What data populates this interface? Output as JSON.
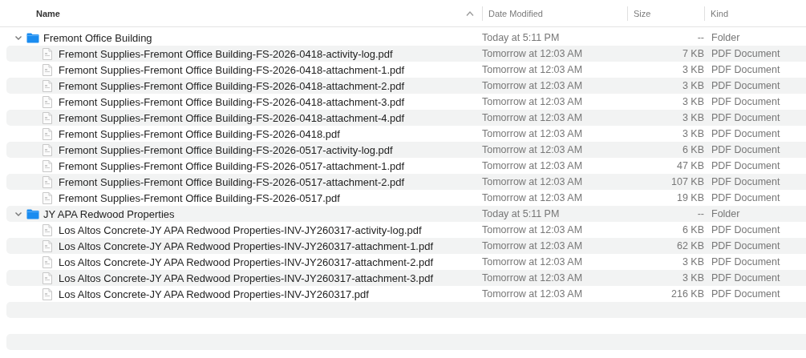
{
  "columns": [
    {
      "label": "Name",
      "sorted": true
    },
    {
      "label": "Date Modified",
      "sorted": false
    },
    {
      "label": "Size",
      "sorted": false
    },
    {
      "label": "Kind",
      "sorted": false
    }
  ],
  "items": [
    {
      "kind": "folder",
      "name": "Fremont Office Building",
      "date": "Today at 5:11 PM",
      "size": "--",
      "type": "Folder",
      "expanded": true,
      "children": [
        {
          "kind": "file",
          "name": "Fremont Supplies-Fremont Office Building-FS-2026-0418-activity-log.pdf",
          "date": "Tomorrow at 12:03 AM",
          "size": "7 KB",
          "type": "PDF Document"
        },
        {
          "kind": "file",
          "name": "Fremont Supplies-Fremont Office Building-FS-2026-0418-attachment-1.pdf",
          "date": "Tomorrow at 12:03 AM",
          "size": "3 KB",
          "type": "PDF Document"
        },
        {
          "kind": "file",
          "name": "Fremont Supplies-Fremont Office Building-FS-2026-0418-attachment-2.pdf",
          "date": "Tomorrow at 12:03 AM",
          "size": "3 KB",
          "type": "PDF Document"
        },
        {
          "kind": "file",
          "name": "Fremont Supplies-Fremont Office Building-FS-2026-0418-attachment-3.pdf",
          "date": "Tomorrow at 12:03 AM",
          "size": "3 KB",
          "type": "PDF Document"
        },
        {
          "kind": "file",
          "name": "Fremont Supplies-Fremont Office Building-FS-2026-0418-attachment-4.pdf",
          "date": "Tomorrow at 12:03 AM",
          "size": "3 KB",
          "type": "PDF Document"
        },
        {
          "kind": "file",
          "name": "Fremont Supplies-Fremont Office Building-FS-2026-0418.pdf",
          "date": "Tomorrow at 12:03 AM",
          "size": "3 KB",
          "type": "PDF Document"
        },
        {
          "kind": "file",
          "name": "Fremont Supplies-Fremont Office Building-FS-2026-0517-activity-log.pdf",
          "date": "Tomorrow at 12:03 AM",
          "size": "6 KB",
          "type": "PDF Document"
        },
        {
          "kind": "file",
          "name": "Fremont Supplies-Fremont Office Building-FS-2026-0517-attachment-1.pdf",
          "date": "Tomorrow at 12:03 AM",
          "size": "47 KB",
          "type": "PDF Document"
        },
        {
          "kind": "file",
          "name": "Fremont Supplies-Fremont Office Building-FS-2026-0517-attachment-2.pdf",
          "date": "Tomorrow at 12:03 AM",
          "size": "107 KB",
          "type": "PDF Document"
        },
        {
          "kind": "file",
          "name": "Fremont Supplies-Fremont Office Building-FS-2026-0517.pdf",
          "date": "Tomorrow at 12:03 AM",
          "size": "19 KB",
          "type": "PDF Document"
        }
      ]
    },
    {
      "kind": "folder",
      "name": "JY APA Redwood Properties",
      "date": "Today at 5:11 PM",
      "size": "--",
      "type": "Folder",
      "expanded": true,
      "children": [
        {
          "kind": "file",
          "name": "Los Altos Concrete-JY APA Redwood Properties-INV-JY260317-activity-log.pdf",
          "date": "Tomorrow at 12:03 AM",
          "size": "6 KB",
          "type": "PDF Document"
        },
        {
          "kind": "file",
          "name": "Los Altos Concrete-JY APA Redwood Properties-INV-JY260317-attachment-1.pdf",
          "date": "Tomorrow at 12:03 AM",
          "size": "62 KB",
          "type": "PDF Document"
        },
        {
          "kind": "file",
          "name": "Los Altos Concrete-JY APA Redwood Properties-INV-JY260317-attachment-2.pdf",
          "date": "Tomorrow at 12:03 AM",
          "size": "3 KB",
          "type": "PDF Document"
        },
        {
          "kind": "file",
          "name": "Los Altos Concrete-JY APA Redwood Properties-INV-JY260317-attachment-3.pdf",
          "date": "Tomorrow at 12:03 AM",
          "size": "3 KB",
          "type": "PDF Document"
        },
        {
          "kind": "file",
          "name": "Los Altos Concrete-JY APA Redwood Properties-INV-JY260317.pdf",
          "date": "Tomorrow at 12:03 AM",
          "size": "216 KB",
          "type": "PDF Document"
        }
      ]
    }
  ]
}
